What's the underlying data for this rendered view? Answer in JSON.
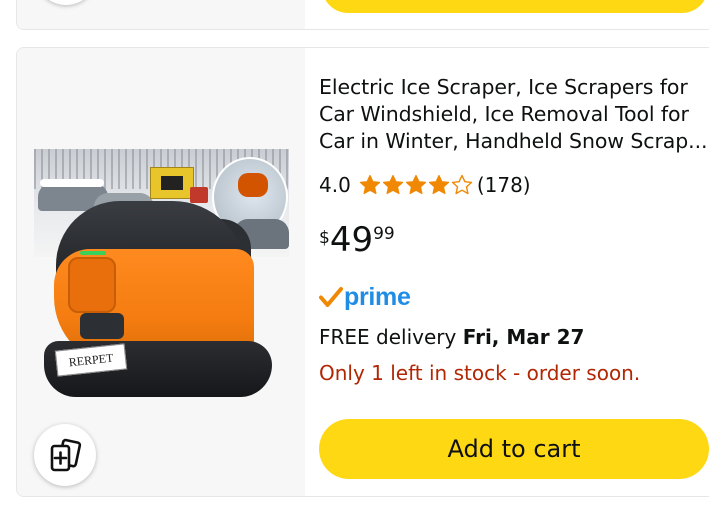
{
  "product": {
    "title_lines": [
      "Electric Ice Scraper, Ice Scrapers for",
      "Car Windshield, Ice Removal Tool for",
      "Car in Winter, Handheld Snow Scrap..."
    ],
    "image_label": "RERPET",
    "rating": {
      "value": "4.0",
      "stars_filled": 4,
      "stars_total": 5,
      "reviews": "(178)"
    },
    "price": {
      "currency": "$",
      "whole": "49",
      "fraction": "99"
    },
    "prime": {
      "label": "prime",
      "color": "#1f8ce6",
      "check_color": "#f08804"
    },
    "delivery": {
      "prefix": "FREE delivery ",
      "date": "Fri, Mar 27"
    },
    "stock_message": "Only 1 left in stock - order soon.",
    "add_to_cart_label": "Add to cart"
  },
  "colors": {
    "cart_button": "#ffd814",
    "stock_text": "#b12704",
    "star": "#f08804"
  },
  "icons": {
    "compare": "add-to-compare-icon",
    "star": "star-icon",
    "prime_check": "prime-check-icon"
  }
}
